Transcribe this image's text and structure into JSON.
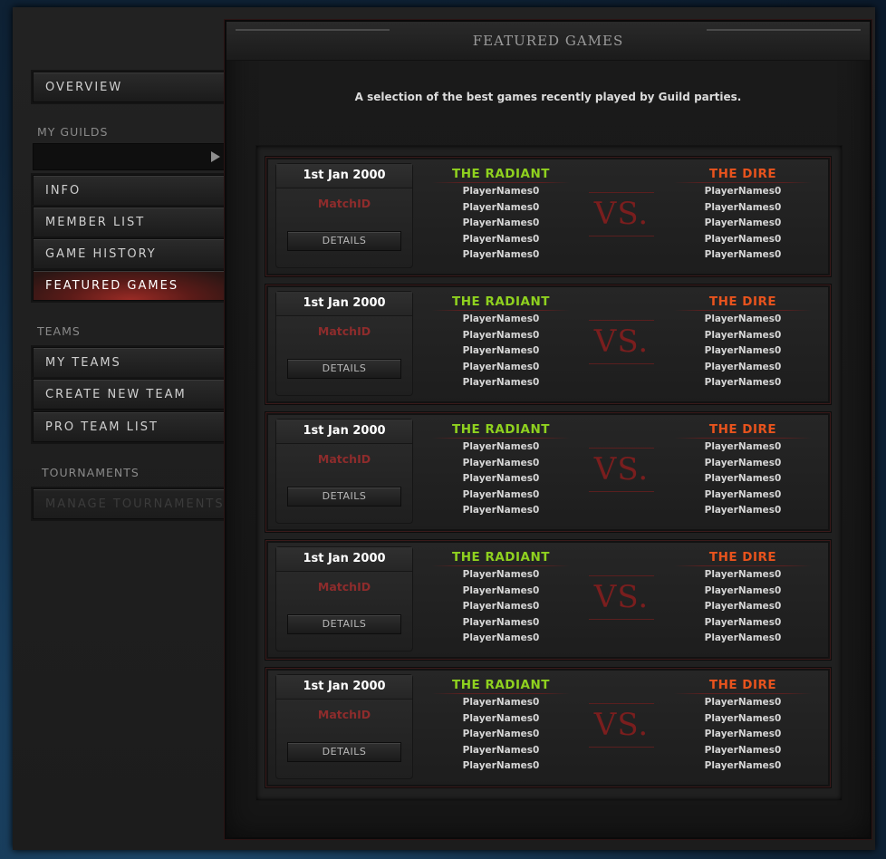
{
  "sidebar": {
    "overview": "OVERVIEW",
    "my_guilds_heading": "MY GUILDS",
    "guild_select_value": "",
    "info": "INFO",
    "member_list": "MEMBER LIST",
    "game_history": "GAME HISTORY",
    "featured_games": "FEATURED GAMES",
    "teams_heading": "TEAMS",
    "my_teams": "MY TEAMS",
    "create_new_team": "CREATE NEW TEAM",
    "pro_team_list": "PRO TEAM LIST",
    "tournaments_heading": "TOURNAMENTS",
    "manage_tournaments": "MANAGE TOURNAMENTS"
  },
  "main": {
    "title": "FEATURED GAMES",
    "subtitle": "A selection of the best games recently played by Guild parties.",
    "vs_label": "VS.",
    "games": [
      {
        "date": "1st Jan 2000",
        "match_id": "MatchID",
        "details": "DETAILS",
        "radiant_label": "THE RADIANT",
        "dire_label": "THE DIRE",
        "radiant": [
          "PlayerNames0",
          "PlayerNames0",
          "PlayerNames0",
          "PlayerNames0",
          "PlayerNames0"
        ],
        "dire": [
          "PlayerNames0",
          "PlayerNames0",
          "PlayerNames0",
          "PlayerNames0",
          "PlayerNames0"
        ]
      },
      {
        "date": "1st Jan 2000",
        "match_id": "MatchID",
        "details": "DETAILS",
        "radiant_label": "THE RADIANT",
        "dire_label": "THE DIRE",
        "radiant": [
          "PlayerNames0",
          "PlayerNames0",
          "PlayerNames0",
          "PlayerNames0",
          "PlayerNames0"
        ],
        "dire": [
          "PlayerNames0",
          "PlayerNames0",
          "PlayerNames0",
          "PlayerNames0",
          "PlayerNames0"
        ]
      },
      {
        "date": "1st Jan 2000",
        "match_id": "MatchID",
        "details": "DETAILS",
        "radiant_label": "THE RADIANT",
        "dire_label": "THE DIRE",
        "radiant": [
          "PlayerNames0",
          "PlayerNames0",
          "PlayerNames0",
          "PlayerNames0",
          "PlayerNames0"
        ],
        "dire": [
          "PlayerNames0",
          "PlayerNames0",
          "PlayerNames0",
          "PlayerNames0",
          "PlayerNames0"
        ]
      },
      {
        "date": "1st Jan 2000",
        "match_id": "MatchID",
        "details": "DETAILS",
        "radiant_label": "THE RADIANT",
        "dire_label": "THE DIRE",
        "radiant": [
          "PlayerNames0",
          "PlayerNames0",
          "PlayerNames0",
          "PlayerNames0",
          "PlayerNames0"
        ],
        "dire": [
          "PlayerNames0",
          "PlayerNames0",
          "PlayerNames0",
          "PlayerNames0",
          "PlayerNames0"
        ]
      },
      {
        "date": "1st Jan 2000",
        "match_id": "MatchID",
        "details": "DETAILS",
        "radiant_label": "THE RADIANT",
        "dire_label": "THE DIRE",
        "radiant": [
          "PlayerNames0",
          "PlayerNames0",
          "PlayerNames0",
          "PlayerNames0",
          "PlayerNames0"
        ],
        "dire": [
          "PlayerNames0",
          "PlayerNames0",
          "PlayerNames0",
          "PlayerNames0",
          "PlayerNames0"
        ]
      }
    ]
  },
  "colors": {
    "radiant": "#8fd11f",
    "dire": "#e8531d",
    "accent_red": "#8e2c2c"
  },
  "icons": {
    "guild_select": "play-triangle-icon"
  }
}
